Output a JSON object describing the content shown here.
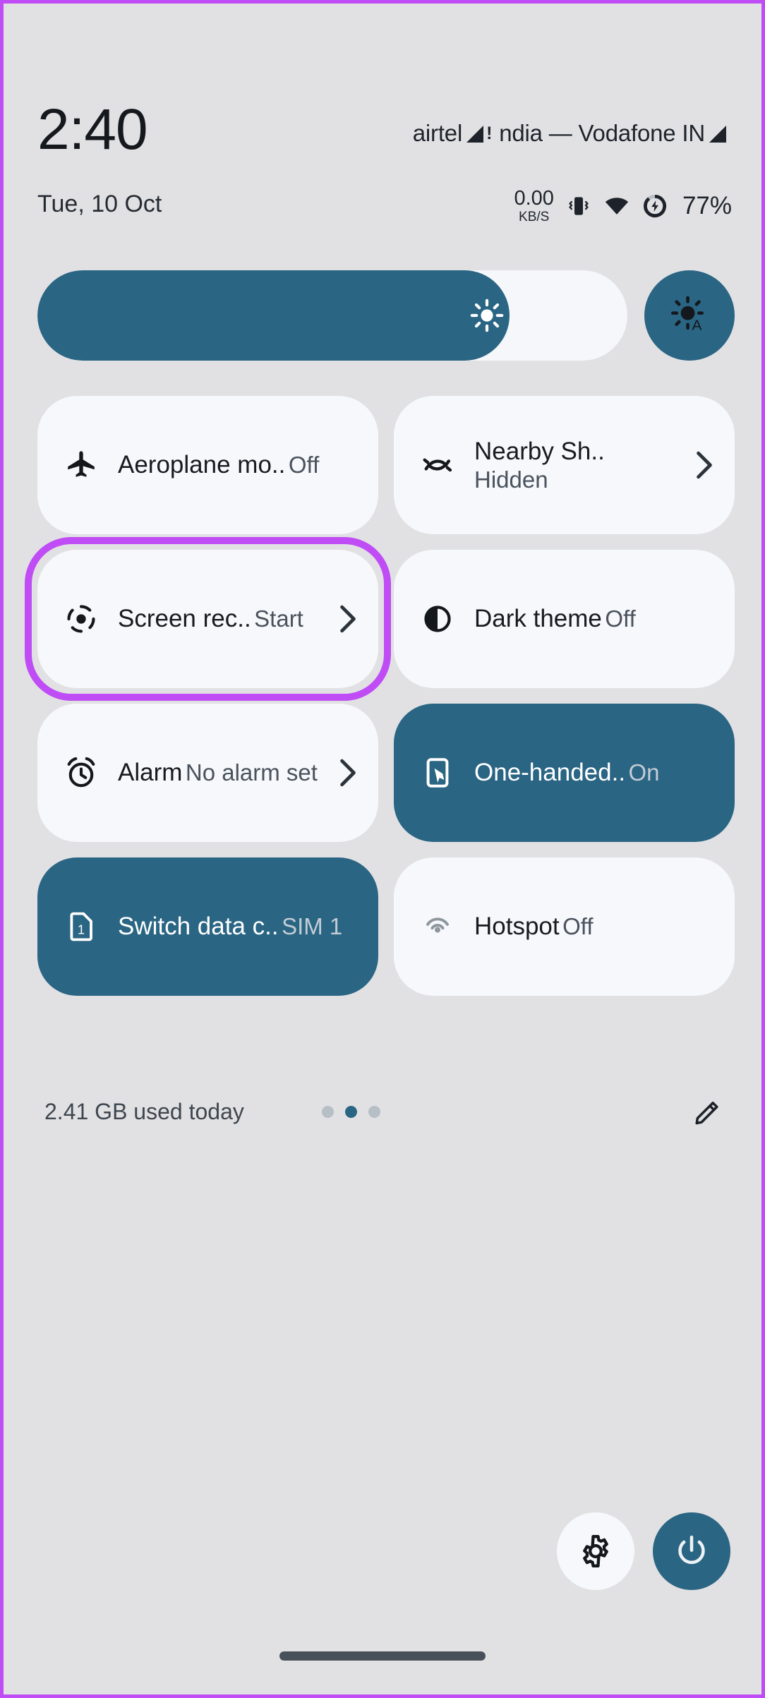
{
  "theme": {
    "background": "#e1e1e3",
    "tile_off_bg": "#f6f8fb",
    "tile_on_bg": "#2a6584",
    "accent": "#2a6584",
    "highlight": "#bf4cf5",
    "text_primary": "#171b21",
    "text_secondary": "#4a525d"
  },
  "status_bar": {
    "carrier_1": "airtel",
    "signal_1_icon": "signal-bars-icon",
    "signal_1_alert": "!",
    "carrier_2": "ndia — Vodafone IN",
    "signal_2_icon": "signal-bars-icon"
  },
  "clock": {
    "time": "2:40",
    "date": "Tue, 10 Oct"
  },
  "status_icons": {
    "net_speed_value": "0.00",
    "net_speed_unit": "KB/S",
    "vibrate_icon": "vibrate-icon",
    "wifi_icon": "wifi-icon",
    "battery_icon": "battery-charging-icon",
    "battery_percent": "77%"
  },
  "brightness": {
    "slider_icon": "brightness-sun-icon",
    "fill_percent": 80,
    "auto_button_icon": "brightness-auto-icon"
  },
  "tiles": [
    {
      "id": "aeroplane-mode",
      "icon": "airplane-icon",
      "title": "Aeroplane mo..",
      "subtitle": "Off",
      "state": "off",
      "has_chevron": false,
      "highlighted": false
    },
    {
      "id": "nearby-share",
      "icon": "nearby-share-icon",
      "title": "Nearby Sh..",
      "subtitle": "Hidden",
      "state": "off",
      "has_chevron": true,
      "highlighted": false
    },
    {
      "id": "screen-record",
      "icon": "screen-record-icon",
      "title": "Screen rec..",
      "subtitle": "Start",
      "state": "off",
      "has_chevron": true,
      "highlighted": true
    },
    {
      "id": "dark-theme",
      "icon": "dark-theme-icon",
      "title": "Dark theme",
      "subtitle": "Off",
      "state": "off",
      "has_chevron": false,
      "highlighted": false
    },
    {
      "id": "alarm",
      "icon": "alarm-clock-icon",
      "title": "Alarm",
      "subtitle": "No alarm set",
      "state": "off",
      "has_chevron": true,
      "highlighted": false
    },
    {
      "id": "one-handed-mode",
      "icon": "one-handed-icon",
      "title": "One-handed..",
      "subtitle": "On",
      "state": "on",
      "has_chevron": false,
      "highlighted": false
    },
    {
      "id": "switch-data-card",
      "icon": "sim-card-1-icon",
      "title": "Switch data c..",
      "subtitle": "SIM 1",
      "state": "on",
      "has_chevron": false,
      "highlighted": false
    },
    {
      "id": "hotspot",
      "icon": "hotspot-icon",
      "title": "Hotspot",
      "subtitle": "Off",
      "state": "off",
      "has_chevron": false,
      "highlighted": false
    }
  ],
  "footer": {
    "data_used": "2.41 GB used today",
    "pages_total": 3,
    "page_active_index": 1,
    "edit_icon": "pencil-edit-icon"
  },
  "bottom_actions": {
    "settings_icon": "gear-icon",
    "power_icon": "power-icon"
  },
  "nav": {
    "gesture_pill": "home-gesture-pill"
  }
}
